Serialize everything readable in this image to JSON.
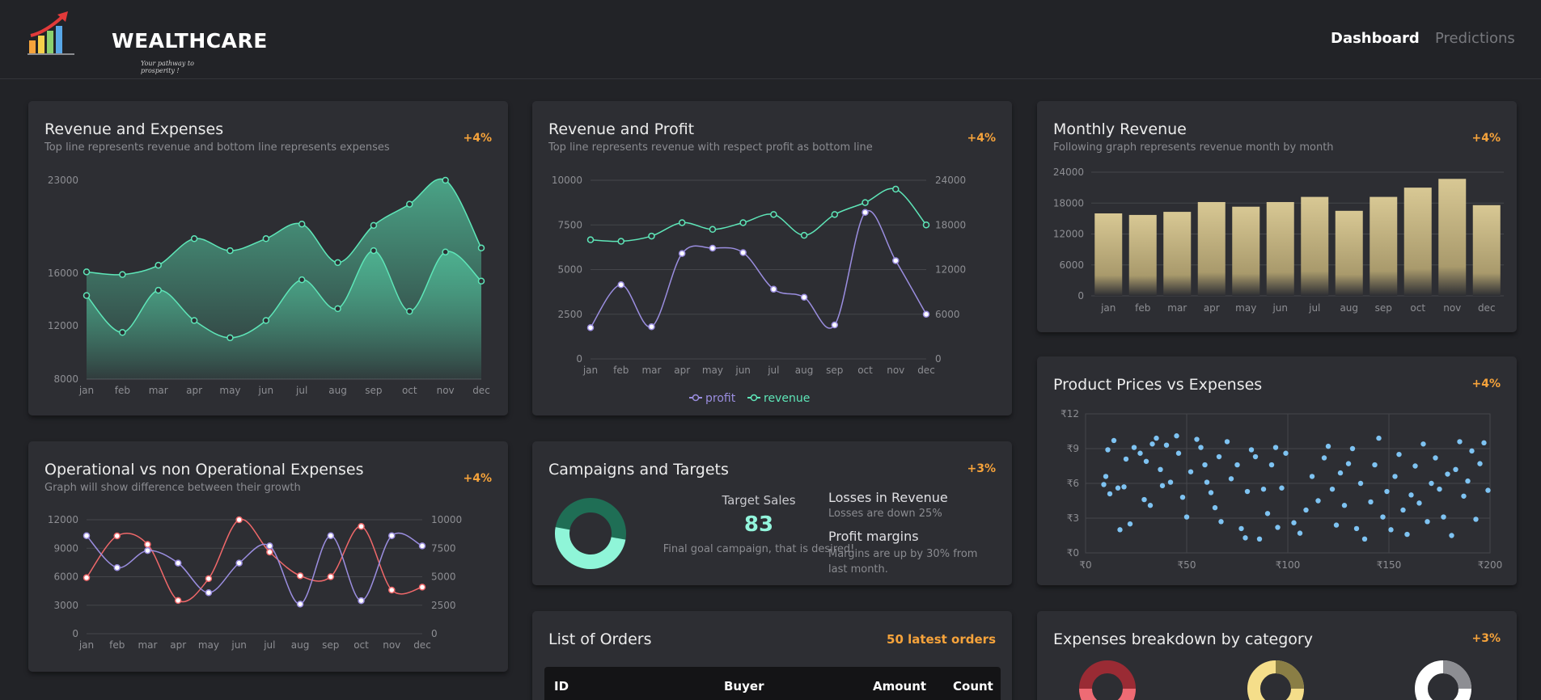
{
  "header": {
    "brand": "WEALTHCARE",
    "tagline": "Your pathway to prosperity !",
    "nav": [
      "Dashboard",
      "Predictions"
    ]
  },
  "colors": {
    "background": "#222327",
    "card": "#2d2e33",
    "accent_green": "#5ee6b8",
    "accent_purple": "#9b8ee0",
    "accent_red": "#f0686a",
    "accent_orange": "#f6a33b",
    "bar_gold": "#d8c894",
    "scatter_blue": "#7ec3f2"
  },
  "cards": {
    "rev_exp": {
      "title": "Revenue and Expenses",
      "subtitle": "Top line represents revenue and bottom line represents expenses",
      "badge": "+4%"
    },
    "rev_profit": {
      "title": "Revenue and Profit",
      "subtitle": "Top line represents revenue with respect profit as bottom line",
      "badge": "+4%",
      "legend": [
        "profit",
        "revenue"
      ]
    },
    "monthly": {
      "title": "Monthly Revenue",
      "subtitle": "Following graph represents revenue month by month",
      "badge": "+4%"
    },
    "op_nonop": {
      "title": "Operational vs non Operational Expenses",
      "subtitle": "Graph will show difference between their growth",
      "badge": "+4%"
    },
    "campaigns": {
      "title": "Campaigns and Targets",
      "badge": "+3%",
      "target_label": "Target Sales",
      "target_value": "83",
      "target_desc": "Final goal campaign, that is desired!",
      "losses_title": "Losses in Revenue",
      "losses_sub": "Losses are down 25%",
      "profit_title": "Profit margins",
      "profit_sub": "Margins are up by 30% from last month.",
      "donut_fraction": 0.83
    },
    "prices": {
      "title": "Product Prices vs Expenses",
      "badge": "+4%"
    },
    "orders": {
      "title": "List of Orders",
      "badge": "50 latest orders",
      "columns": [
        "ID",
        "Buyer",
        "Amount",
        "Count"
      ]
    },
    "breakdown": {
      "title": "Expenses breakdown by category",
      "badge": "+3%"
    }
  },
  "chart_data": [
    {
      "id": "rev_exp",
      "type": "area",
      "categories": [
        "jan",
        "feb",
        "mar",
        "apr",
        "may",
        "jun",
        "jul",
        "aug",
        "sep",
        "oct",
        "nov",
        "dec"
      ],
      "y_ticks": [
        "23000",
        "16000",
        "12000",
        "8000"
      ],
      "series": [
        {
          "values": [
            16100,
            15900,
            16600,
            18600,
            17700,
            18600,
            19700,
            16800,
            19600,
            21200,
            23000,
            17900
          ]
        },
        {
          "values": [
            14300,
            11500,
            14700,
            12400,
            11100,
            12400,
            15500,
            13300,
            17700,
            13100,
            17600,
            15400
          ]
        }
      ]
    },
    {
      "id": "rev_profit",
      "type": "line",
      "categories": [
        "jan",
        "feb",
        "mar",
        "apr",
        "may",
        "jun",
        "jul",
        "aug",
        "sep",
        "oct",
        "nov",
        "dec"
      ],
      "ylim_left": [
        0,
        10000
      ],
      "y_ticks_left": [
        "0",
        "2500",
        "5000",
        "7500",
        "10000"
      ],
      "ylim_right": [
        0,
        24000
      ],
      "y_ticks_right": [
        "0",
        "6000",
        "12000",
        "18000",
        "24000"
      ],
      "series": [
        {
          "name": "profit",
          "axis": "left",
          "values": [
            1750,
            4150,
            1800,
            5900,
            6200,
            5950,
            3900,
            3450,
            1900,
            8200,
            5500,
            2500
          ]
        },
        {
          "name": "revenue",
          "axis": "right",
          "values": [
            16000,
            15800,
            16500,
            18300,
            17400,
            18300,
            19400,
            16600,
            19400,
            21000,
            22800,
            18000
          ]
        }
      ]
    },
    {
      "id": "monthly",
      "type": "bar",
      "categories": [
        "jan",
        "feb",
        "mar",
        "apr",
        "may",
        "jun",
        "jul",
        "aug",
        "sep",
        "oct",
        "nov",
        "dec"
      ],
      "ylim": [
        0,
        24000
      ],
      "y_ticks": [
        "0",
        "6000",
        "12000",
        "18000",
        "24000"
      ],
      "values": [
        16000,
        15700,
        16300,
        18200,
        17300,
        18200,
        19200,
        16500,
        19200,
        21000,
        22700,
        17600
      ]
    },
    {
      "id": "op_nonop",
      "type": "line",
      "categories": [
        "jan",
        "feb",
        "mar",
        "apr",
        "may",
        "jun",
        "jul",
        "aug",
        "sep",
        "oct",
        "nov",
        "dec"
      ],
      "ylim_left": [
        0,
        12000
      ],
      "y_ticks_left": [
        "0",
        "3000",
        "6000",
        "9000",
        "12000"
      ],
      "ylim_right": [
        0,
        10000
      ],
      "y_ticks_right": [
        "0",
        "2500",
        "5000",
        "7500",
        "10000"
      ],
      "series": [
        {
          "axis": "left",
          "values": [
            5900,
            10300,
            9400,
            3500,
            5800,
            12000,
            8600,
            6100,
            6000,
            11300,
            4600,
            4900
          ]
        },
        {
          "axis": "right",
          "values": [
            8600,
            5800,
            7300,
            6200,
            3600,
            6200,
            7700,
            2600,
            8600,
            2900,
            8600,
            7700
          ]
        }
      ]
    },
    {
      "id": "prices",
      "type": "scatter",
      "xlim": [
        0,
        200
      ],
      "x_ticks": [
        "₹0",
        "₹50",
        "₹100",
        "₹150",
        "₹200"
      ],
      "ylim": [
        0,
        12
      ],
      "y_ticks": [
        "₹0",
        "₹3",
        "₹6",
        "₹9",
        "₹12"
      ],
      "points": [
        [
          14,
          9.7
        ],
        [
          11,
          8.9
        ],
        [
          9,
          5.9
        ],
        [
          10,
          6.6
        ],
        [
          12,
          5.1
        ],
        [
          16,
          5.6
        ],
        [
          19,
          5.7
        ],
        [
          20,
          8.1
        ],
        [
          22,
          2.5
        ],
        [
          17,
          2.0
        ],
        [
          24,
          9.1
        ],
        [
          27,
          8.6
        ],
        [
          29,
          4.6
        ],
        [
          32,
          4.1
        ],
        [
          30,
          7.9
        ],
        [
          33,
          9.4
        ],
        [
          35,
          9.9
        ],
        [
          37,
          7.2
        ],
        [
          38,
          5.8
        ],
        [
          40,
          9.3
        ],
        [
          42,
          6.1
        ],
        [
          45,
          10.1
        ],
        [
          46,
          8.6
        ],
        [
          48,
          4.8
        ],
        [
          50,
          3.1
        ],
        [
          52,
          7.0
        ],
        [
          55,
          9.8
        ],
        [
          57,
          9.1
        ],
        [
          59,
          7.6
        ],
        [
          60,
          6.1
        ],
        [
          62,
          5.2
        ],
        [
          64,
          3.9
        ],
        [
          66,
          8.3
        ],
        [
          67,
          2.7
        ],
        [
          70,
          9.6
        ],
        [
          72,
          6.4
        ],
        [
          75,
          7.6
        ],
        [
          77,
          2.1
        ],
        [
          79,
          1.3
        ],
        [
          80,
          5.3
        ],
        [
          82,
          8.9
        ],
        [
          84,
          8.3
        ],
        [
          86,
          1.2
        ],
        [
          88,
          5.5
        ],
        [
          90,
          3.4
        ],
        [
          92,
          7.6
        ],
        [
          94,
          9.1
        ],
        [
          95,
          2.2
        ],
        [
          97,
          5.6
        ],
        [
          99,
          8.6
        ],
        [
          103,
          2.6
        ],
        [
          106,
          1.7
        ],
        [
          109,
          3.7
        ],
        [
          112,
          6.6
        ],
        [
          115,
          4.5
        ],
        [
          118,
          8.2
        ],
        [
          120,
          9.2
        ],
        [
          122,
          5.5
        ],
        [
          124,
          2.4
        ],
        [
          126,
          6.9
        ],
        [
          128,
          4.1
        ],
        [
          130,
          7.7
        ],
        [
          132,
          9.0
        ],
        [
          134,
          2.1
        ],
        [
          136,
          6.0
        ],
        [
          138,
          1.2
        ],
        [
          141,
          4.4
        ],
        [
          143,
          7.6
        ],
        [
          145,
          9.9
        ],
        [
          147,
          3.1
        ],
        [
          149,
          5.3
        ],
        [
          151,
          2.0
        ],
        [
          153,
          6.6
        ],
        [
          155,
          8.5
        ],
        [
          157,
          3.7
        ],
        [
          159,
          1.6
        ],
        [
          161,
          5.0
        ],
        [
          163,
          7.5
        ],
        [
          165,
          4.3
        ],
        [
          167,
          9.4
        ],
        [
          169,
          2.7
        ],
        [
          171,
          6.0
        ],
        [
          173,
          8.2
        ],
        [
          175,
          5.5
        ],
        [
          177,
          3.1
        ],
        [
          179,
          6.8
        ],
        [
          181,
          1.5
        ],
        [
          183,
          7.2
        ],
        [
          185,
          9.6
        ],
        [
          187,
          4.9
        ],
        [
          189,
          6.2
        ],
        [
          191,
          8.8
        ],
        [
          193,
          2.9
        ],
        [
          195,
          7.7
        ],
        [
          197,
          9.5
        ],
        [
          199,
          5.4
        ]
      ]
    }
  ]
}
